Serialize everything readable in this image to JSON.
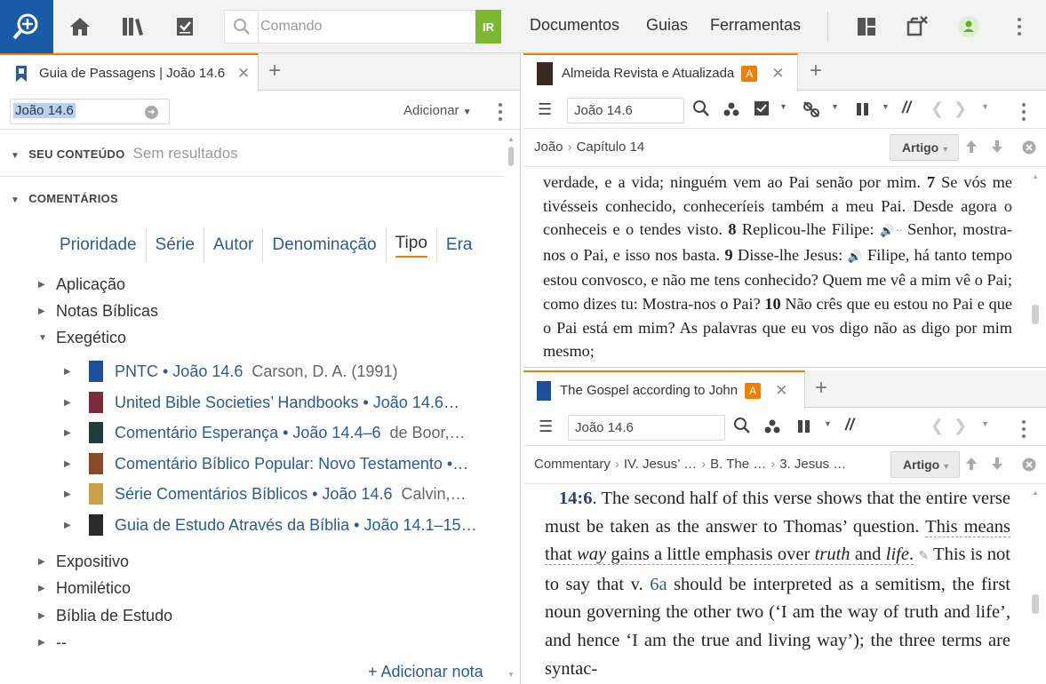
{
  "topbar": {
    "command_placeholder": "Comando",
    "ir_label": "IR",
    "menu": [
      "Documentos",
      "Guias",
      "Ferramentas"
    ],
    "icons": [
      "home-icon",
      "library-icon",
      "checklist-icon",
      "layout-icon",
      "close-panels-icon",
      "user-status-icon",
      "more-icon"
    ]
  },
  "left_panel": {
    "tab_title": "Guia de Passagens | João 14.6",
    "reference": "João 14.6",
    "add_label": "Adicionar",
    "your_content": {
      "heading": "SEU CONTEÚDO",
      "status": "Sem resultados"
    },
    "commentaries": {
      "heading": "COMENTÁRIOS",
      "filters": [
        "Prioridade",
        "Série",
        "Autor",
        "Denominação",
        "Tipo",
        "Era"
      ],
      "active_filter": "Tipo",
      "categories_top": [
        "Aplicação",
        "Notas Bíblicas",
        "Exegético"
      ],
      "books": [
        {
          "title": "PNTC • João 14.6",
          "author": "Carson, D. A. (1991)",
          "color": "#1d4f9c"
        },
        {
          "title": "United Bible Societies’ Handbooks • João 14.6…",
          "author": "",
          "color": "#7a2a3a"
        },
        {
          "title": "Comentário Esperança • João 14.4–6",
          "author": "de Boor,…",
          "color": "#1f3d3a"
        },
        {
          "title": "Comentário Bíblico Popular: Novo Testamento •…",
          "author": "",
          "color": "#8a4a2a"
        },
        {
          "title": "Série Comentários Bíblicos • João 14.6",
          "author": "Calvin,…",
          "color": "#c9a24a"
        },
        {
          "title": "Guia de Estudo Através da Bíblia • João 14.1–15…",
          "author": "",
          "color": "#2a2a2a"
        }
      ],
      "categories_bottom": [
        "Expositivo",
        "Homilético",
        "Bíblia de Estudo",
        "--"
      ]
    },
    "add_note": "+ Adicionar nota"
  },
  "bible_panel": {
    "tab_title": "Almeida Revista e Atualizada",
    "badge": "A",
    "reference": "João 14.6",
    "crumbs": [
      "João",
      "Capítulo 14"
    ],
    "view_label": "Artigo",
    "text": {
      "p1": "verdade, e a vida; ninguém vem ao Pai senão por mim.",
      "v7": "7",
      "p2": "Se vós me tivésseis conhecido, conheceríeis também a meu Pai. Desde agora o conheceis e o tendes visto.",
      "v8": "8",
      "p3": "Replicou-lhe Filipe:",
      "p4": "Senhor, mostra-nos o Pai, e isso nos basta.",
      "v9": "9",
      "p5": "Disse-lhe Jesus:",
      "p6": "Filipe, há tanto tempo estou convosco, e não me tens conhecido? Quem me vê a mim vê o Pai; como dizes tu: Mostra-nos o Pai?",
      "v10": "10",
      "p7": "Não crês que eu estou no Pai e que o Pai está em mim? As palavras que eu vos digo não as digo por mim mesmo;"
    }
  },
  "commentary_panel": {
    "tab_title": "The Gospel according to John",
    "badge": "A",
    "reference": "João 14.6",
    "crumbs": [
      "Commentary",
      "IV. Jesus’ …",
      "B. The …",
      "3. Jesus …"
    ],
    "view_label": "Artigo",
    "text": {
      "ref": "14:6",
      "s1": ". The second half of this verse shows that the entire verse must be taken as the answer to Thomas’ question.",
      "s2a": "This means that",
      "s2b": "way",
      "s2c": "gains a little emphasis over",
      "s2d": "truth",
      "s2e": "and",
      "s2f": "life",
      "s2g": ".",
      "s3a": "This is not to say that v.",
      "s3link": "6a",
      "s3b": "should be interpreted as a semitism, the first noun governing the other two (‘I am the way of truth and life’, and hence ‘I am the true and living way’); the three terms are syntac-"
    }
  }
}
